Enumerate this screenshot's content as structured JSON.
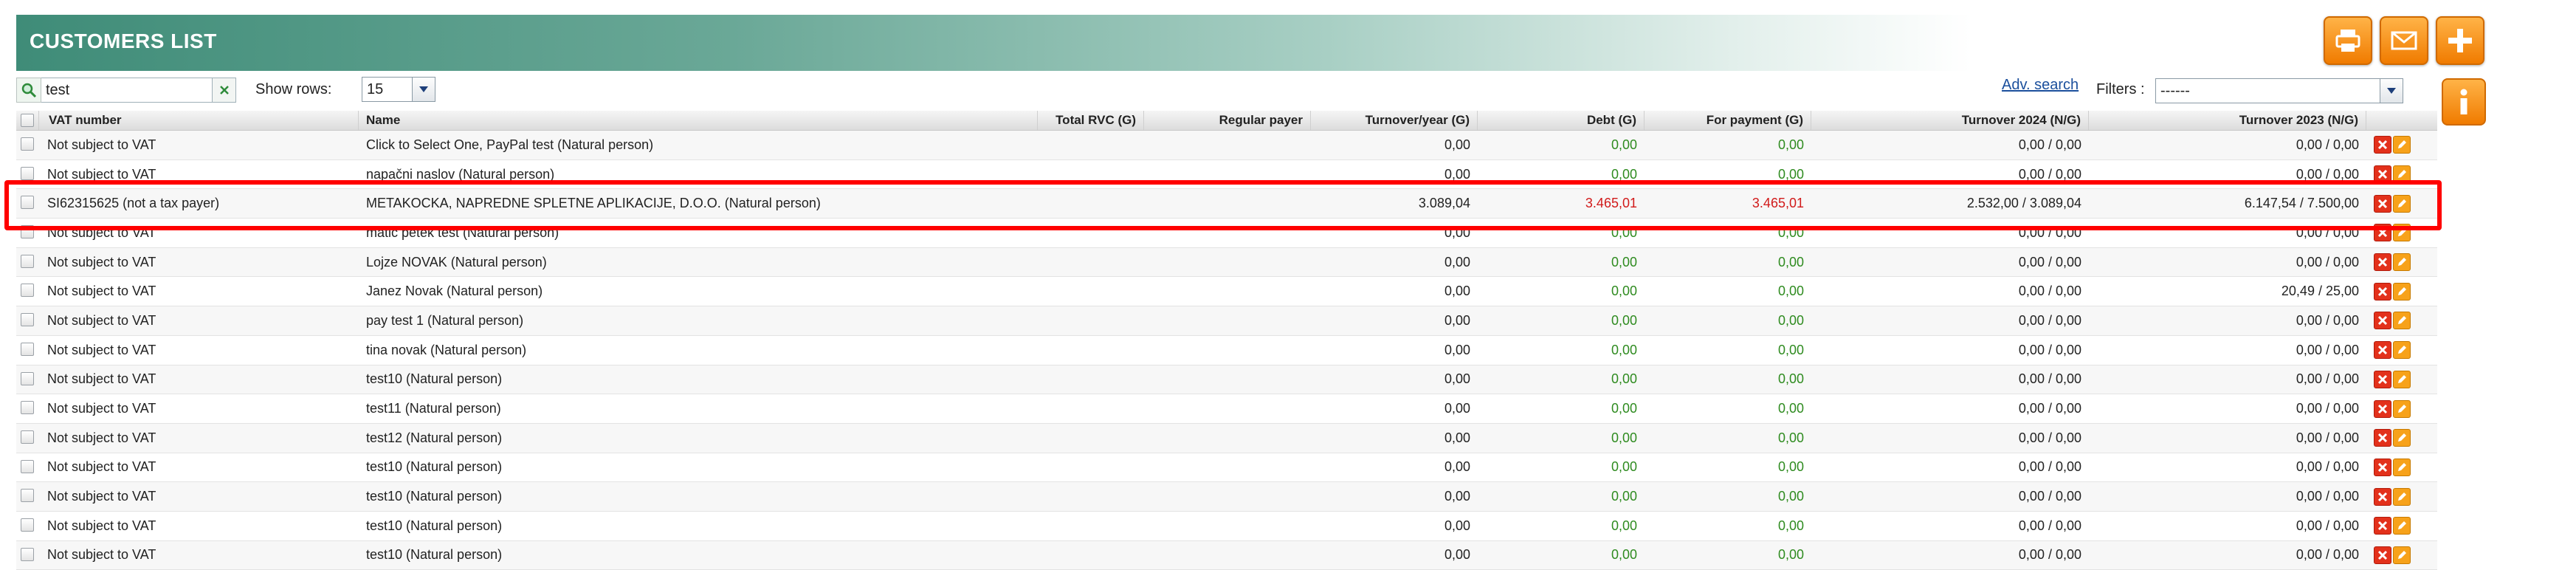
{
  "header": {
    "title": "CUSTOMERS LIST"
  },
  "toolbar": {
    "search_value": "test",
    "show_rows_label": "Show rows:",
    "rows_value": "15",
    "adv_search": "Adv. search",
    "filters_label": "Filters :",
    "filters_value": "------"
  },
  "columns": {
    "vat": "VAT number",
    "name": "Name",
    "total_rvc": "Total RVC (G)",
    "regular_payer": "Regular payer",
    "turnover_year": "Turnover/year (G)",
    "debt": "Debt (G)",
    "for_payment": "For payment (G)",
    "turnover_2024": "Turnover 2024 (N/G)",
    "turnover_2023": "Turnover 2023 (N/G)"
  },
  "rows": [
    {
      "vat": "Not subject to VAT",
      "name": "Click to Select One, PayPal test (Natural person)",
      "turnover": "0,00",
      "debt": "0,00",
      "payment": "0,00",
      "t2024": "0,00 / 0,00",
      "t2023": "0,00 / 0,00",
      "status": "green"
    },
    {
      "vat": "Not subject to VAT",
      "name": "napačni naslov (Natural person)",
      "turnover": "0,00",
      "debt": "0,00",
      "payment": "0,00",
      "t2024": "0,00 / 0,00",
      "t2023": "0,00 / 0,00",
      "status": "green"
    },
    {
      "vat": "SI62315625 (not a tax payer)",
      "name": "METAKOCKA, NAPREDNE SPLETNE APLIKACIJE, D.O.O. (Natural person)",
      "turnover": "3.089,04",
      "debt": "3.465,01",
      "payment": "3.465,01",
      "t2024": "2.532,00 / 3.089,04",
      "t2023": "6.147,54 / 7.500,00",
      "status": "red"
    },
    {
      "vat": "Not subject to VAT",
      "name": "matic petek test (Natural person)",
      "turnover": "0,00",
      "debt": "0,00",
      "payment": "0,00",
      "t2024": "0,00 / 0,00",
      "t2023": "0,00 / 0,00",
      "status": "green"
    },
    {
      "vat": "Not subject to VAT",
      "name": "Lojze NOVAK (Natural person)",
      "turnover": "0,00",
      "debt": "0,00",
      "payment": "0,00",
      "t2024": "0,00 / 0,00",
      "t2023": "0,00 / 0,00",
      "status": "green"
    },
    {
      "vat": "Not subject to VAT",
      "name": "Janez Novak (Natural person)",
      "turnover": "0,00",
      "debt": "0,00",
      "payment": "0,00",
      "t2024": "0,00 / 0,00",
      "t2023": "20,49 / 25,00",
      "status": "green"
    },
    {
      "vat": "Not subject to VAT",
      "name": "pay test 1 (Natural person)",
      "turnover": "0,00",
      "debt": "0,00",
      "payment": "0,00",
      "t2024": "0,00 / 0,00",
      "t2023": "0,00 / 0,00",
      "status": "green"
    },
    {
      "vat": "Not subject to VAT",
      "name": "tina novak (Natural person)",
      "turnover": "0,00",
      "debt": "0,00",
      "payment": "0,00",
      "t2024": "0,00 / 0,00",
      "t2023": "0,00 / 0,00",
      "status": "green"
    },
    {
      "vat": "Not subject to VAT",
      "name": "test10 (Natural person)",
      "turnover": "0,00",
      "debt": "0,00",
      "payment": "0,00",
      "t2024": "0,00 / 0,00",
      "t2023": "0,00 / 0,00",
      "status": "green"
    },
    {
      "vat": "Not subject to VAT",
      "name": "test11 (Natural person)",
      "turnover": "0,00",
      "debt": "0,00",
      "payment": "0,00",
      "t2024": "0,00 / 0,00",
      "t2023": "0,00 / 0,00",
      "status": "green"
    },
    {
      "vat": "Not subject to VAT",
      "name": "test12 (Natural person)",
      "turnover": "0,00",
      "debt": "0,00",
      "payment": "0,00",
      "t2024": "0,00 / 0,00",
      "t2023": "0,00 / 0,00",
      "status": "green"
    },
    {
      "vat": "Not subject to VAT",
      "name": "test10 (Natural person)",
      "turnover": "0,00",
      "debt": "0,00",
      "payment": "0,00",
      "t2024": "0,00 / 0,00",
      "t2023": "0,00 / 0,00",
      "status": "green"
    },
    {
      "vat": "Not subject to VAT",
      "name": "test10 (Natural person)",
      "turnover": "0,00",
      "debt": "0,00",
      "payment": "0,00",
      "t2024": "0,00 / 0,00",
      "t2023": "0,00 / 0,00",
      "status": "green"
    },
    {
      "vat": "Not subject to VAT",
      "name": "test10 (Natural person)",
      "turnover": "0,00",
      "debt": "0,00",
      "payment": "0,00",
      "t2024": "0,00 / 0,00",
      "t2023": "0,00 / 0,00",
      "status": "green"
    },
    {
      "vat": "Not subject to VAT",
      "name": "test10 (Natural person)",
      "turnover": "0,00",
      "debt": "0,00",
      "payment": "0,00",
      "t2024": "0,00 / 0,00",
      "t2023": "0,00 / 0,00",
      "status": "green"
    }
  ],
  "icons": {
    "print": "printer-icon",
    "mail": "envelope-icon",
    "add": "plus-icon",
    "info": "info-icon",
    "search": "magnifier-icon",
    "clear": "close-icon",
    "delete": "delete-icon",
    "edit": "pencil-icon"
  },
  "colors": {
    "accent": "#3f8c78",
    "positive": "#2e8b1f",
    "negative": "#d11a1a",
    "action": "#f07b00",
    "highlight": "#ff0000"
  }
}
